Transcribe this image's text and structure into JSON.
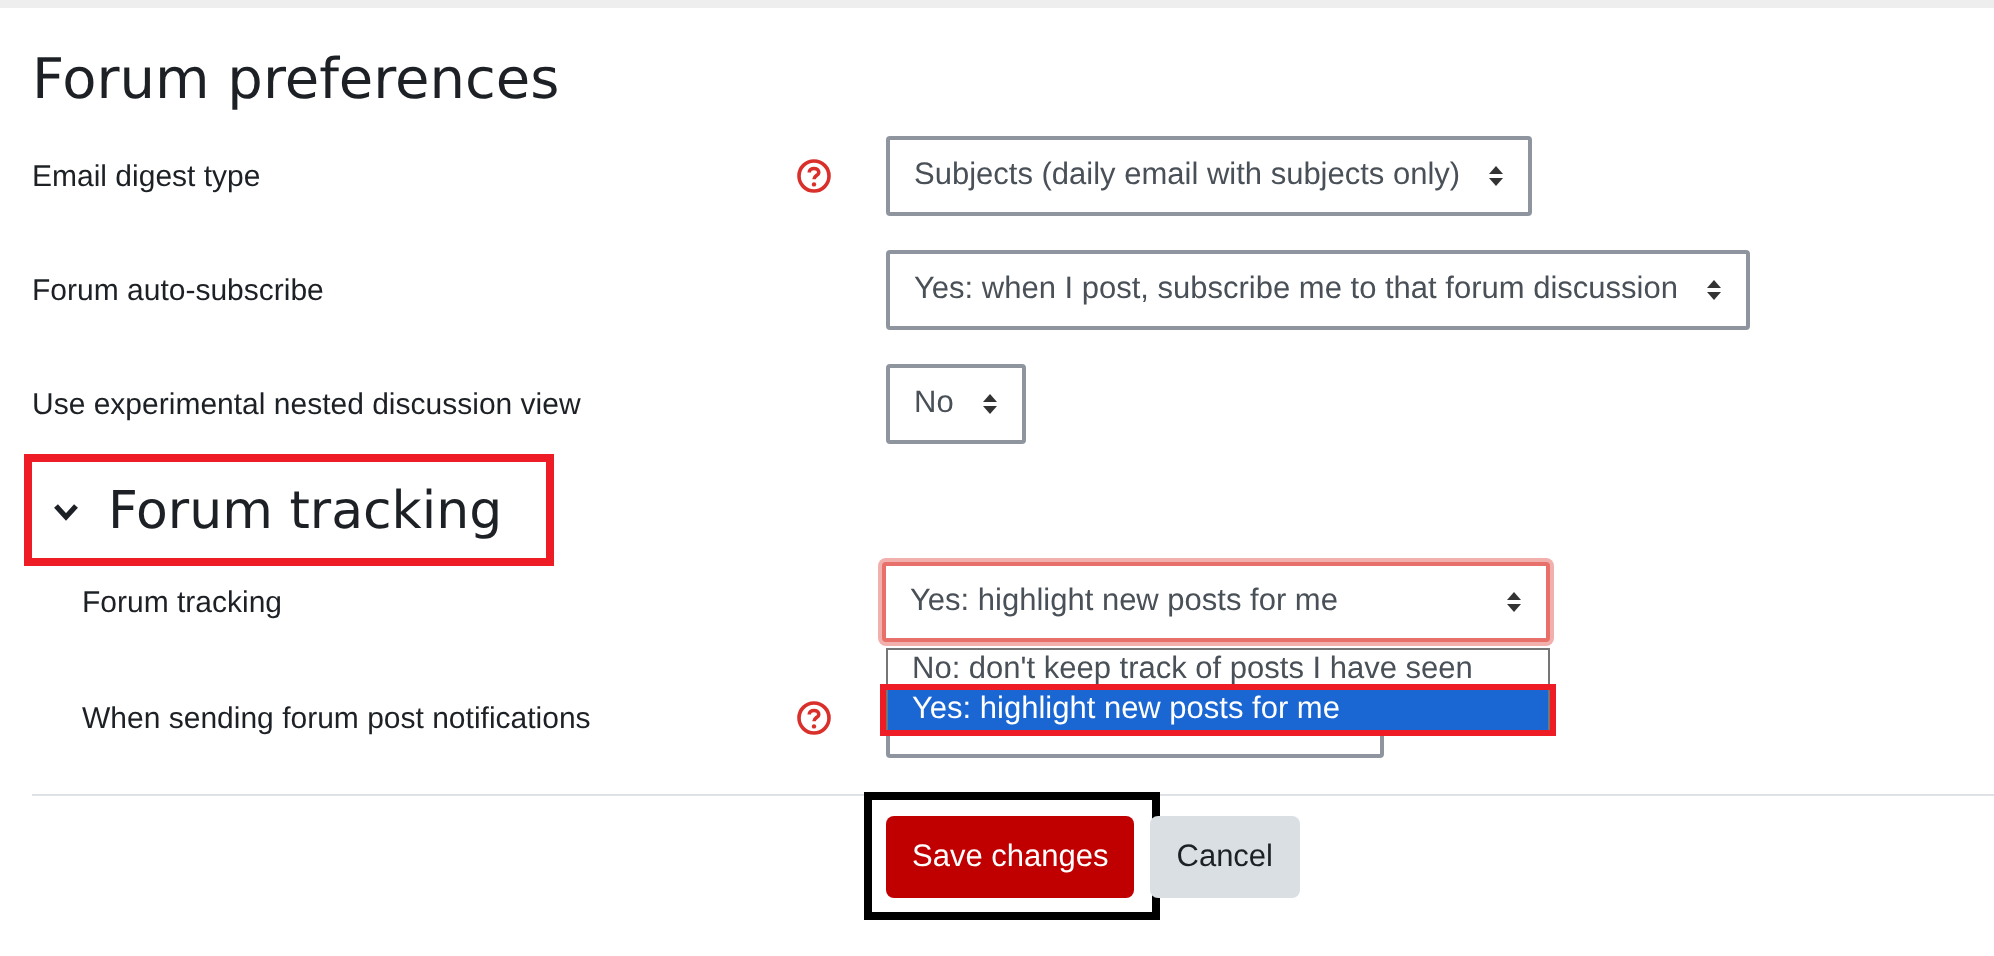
{
  "title": "Forum preferences",
  "fields": [
    {
      "label": "Email digest type",
      "help": true,
      "value": "Subjects (daily email with subjects only)"
    },
    {
      "label": "Forum auto-subscribe",
      "help": false,
      "value": "Yes: when I post, subscribe me to that forum discussion"
    },
    {
      "label": "Use experimental nested discussion view",
      "help": false,
      "value": "No"
    }
  ],
  "section": {
    "title": "Forum tracking",
    "expanded": true,
    "fields": [
      {
        "label": "Forum tracking",
        "help": false,
        "value": "Yes: highlight new posts for me",
        "open": true,
        "options": [
          {
            "label": "No: don't keep track of posts I have seen",
            "selected": false
          },
          {
            "label": "Yes: highlight new posts for me",
            "selected": true
          }
        ]
      },
      {
        "label": "When sending forum post notifications",
        "help": true,
        "open": false
      }
    ]
  },
  "buttons": [
    {
      "label": "Save changes",
      "kind": "primary"
    },
    {
      "label": "Cancel",
      "kind": "secondary"
    }
  ]
}
